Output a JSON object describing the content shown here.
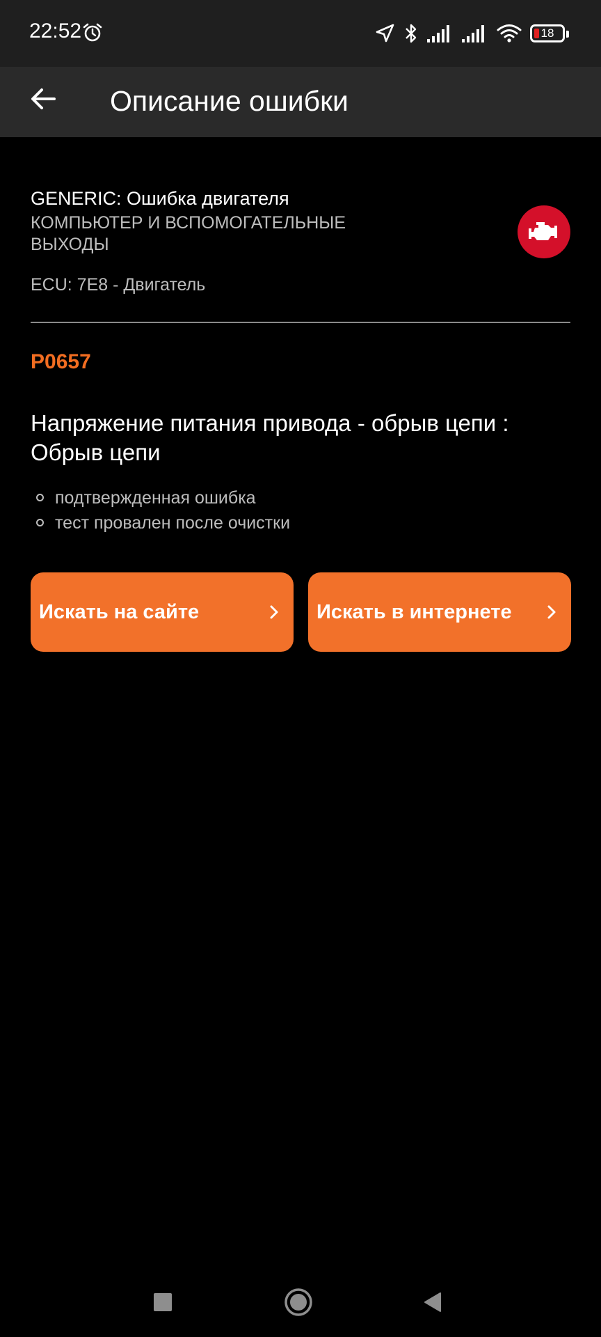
{
  "status_bar": {
    "time": "22:52",
    "battery_level": "18",
    "icons": [
      "alarm-icon",
      "location-icon",
      "bluetooth-icon",
      "signal-icon",
      "signal-icon",
      "wifi-icon",
      "battery-icon"
    ]
  },
  "app_bar": {
    "back_icon": "arrow-left-icon",
    "title": "Описание ошибки"
  },
  "system": {
    "title": "GENERIC: Ошибка двигателя",
    "subtitle": "КОМПЬЮТЕР И ВСПОМОГАТЕЛЬНЫЕ ВЫХОДЫ",
    "ecu": "ECU: 7E8 - Двигатель",
    "badge_icon": "engine-icon",
    "badge_color": "#d4102a"
  },
  "error": {
    "code": "P0657",
    "code_color": "#f26d21",
    "description": "Напряжение питания привода - обрыв цепи : Обрыв цепи",
    "statuses": [
      "подтвержденная ошибка",
      "тест провален после очистки"
    ]
  },
  "actions": {
    "search_site_label": "Искать на сайте",
    "search_internet_label": "Искать в интернете",
    "button_color": "#f2712a",
    "chevron_icon": "chevron-right-icon"
  },
  "nav_bar": {
    "icons": [
      "recents-square-icon",
      "home-circle-icon",
      "back-triangle-icon"
    ]
  }
}
